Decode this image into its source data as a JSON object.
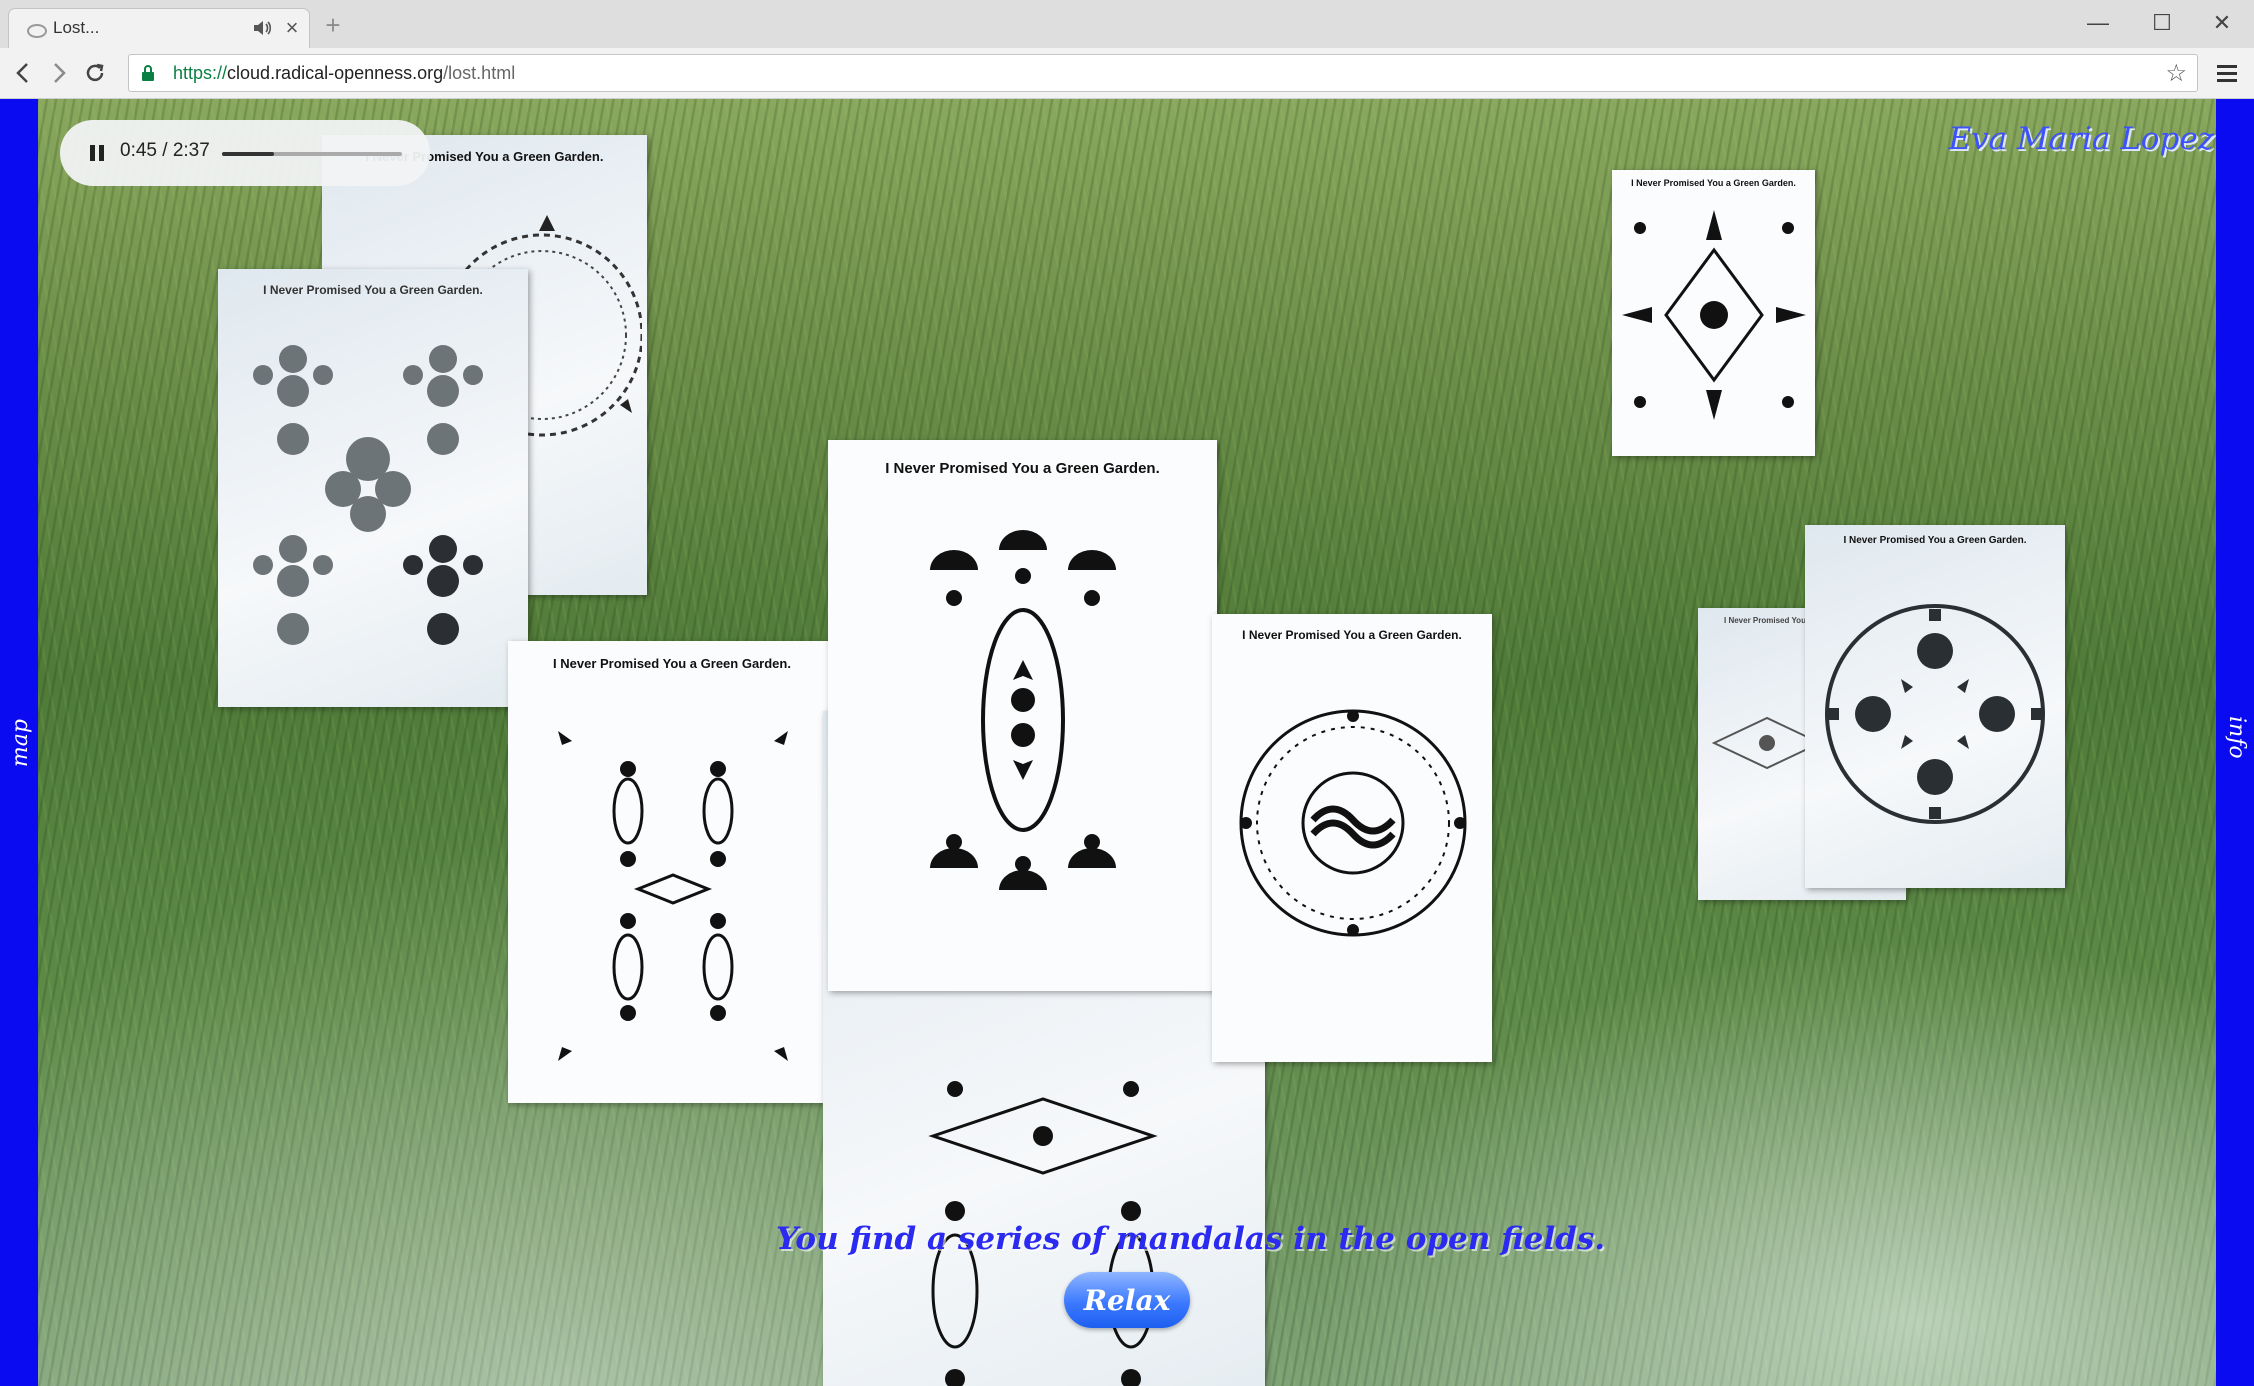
{
  "browser": {
    "tab_title": "Lost...",
    "tab_close": "×",
    "new_tab": "+",
    "window_minimize": "—",
    "window_maximize": "☐",
    "window_close": "✕",
    "url_scheme": "https://",
    "url_host": "cloud.radical-openness.org",
    "url_path": "/lost.html",
    "bookmark": "☆"
  },
  "sidebar": {
    "left_label": "map",
    "right_label": "info",
    "color": "#0b0bf2"
  },
  "player": {
    "time": "0:45 / 2:37",
    "progress": 0.29
  },
  "header": {
    "author": "Eva Maria Lopez"
  },
  "cards": {
    "title": "I Never Promised You a Green Garden."
  },
  "caption": "You find a series of mandalas in the open fields.",
  "button": {
    "label": "Relax"
  }
}
